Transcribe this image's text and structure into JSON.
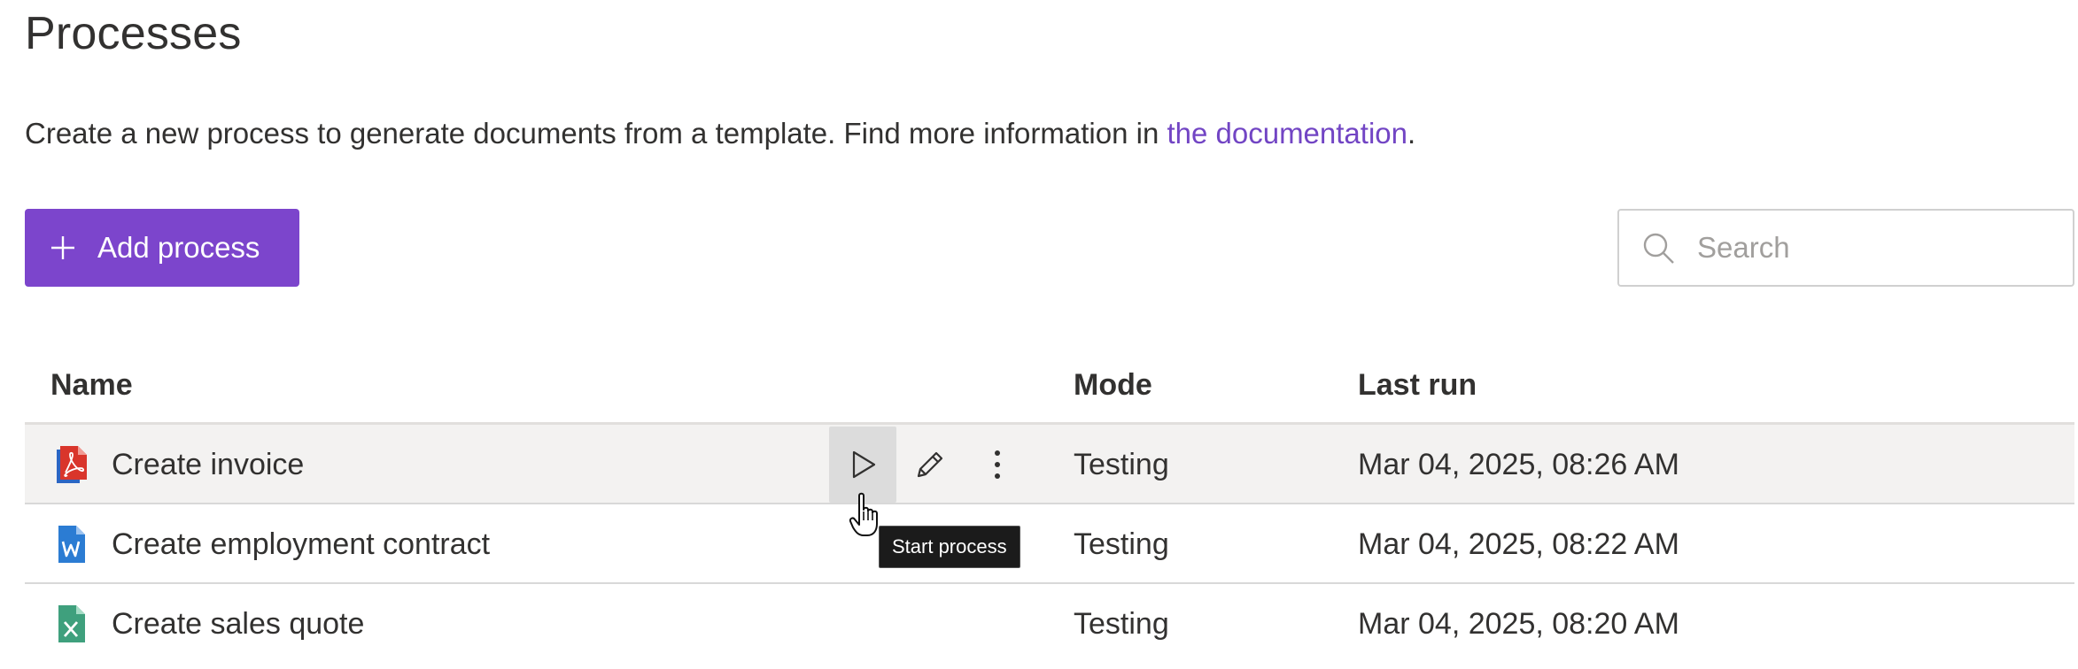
{
  "page": {
    "title": "Processes",
    "intro_text": "Create a new process to generate documents from a template. Find more information in ",
    "intro_link": "the documentation",
    "intro_suffix": "."
  },
  "toolbar": {
    "add_label": "Add process",
    "search_placeholder": "Search"
  },
  "table": {
    "columns": {
      "name": "Name",
      "mode": "Mode",
      "last_run": "Last run"
    },
    "rows": [
      {
        "name": "Create invoice",
        "file_type": "pdf-file-icon",
        "mode": "Testing",
        "last_run": "Mar 04, 2025, 08:26 AM"
      },
      {
        "name": "Create employment contract",
        "file_type": "word-file-icon",
        "mode": "Testing",
        "last_run": "Mar 04, 2025, 08:22 AM"
      },
      {
        "name": "Create sales quote",
        "file_type": "excel-file-icon",
        "mode": "Testing",
        "last_run": "Mar 04, 2025, 08:20 AM"
      }
    ]
  },
  "tooltip": {
    "text": "Start process"
  },
  "colors": {
    "accent": "#7c45cc",
    "link": "#7245c4",
    "pdf": "#d9352b",
    "word": "#2b7cd3",
    "excel": "#3fa07d"
  }
}
